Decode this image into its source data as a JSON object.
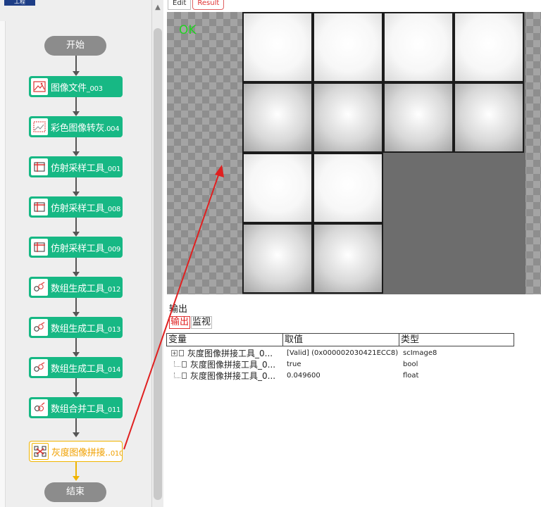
{
  "project_badge": "工程",
  "flow": {
    "start": "开始",
    "end": "结束",
    "nodes": [
      {
        "name": "图像文件",
        "suffix": "_003",
        "icon": "image-file-icon"
      },
      {
        "name": "彩色图像转灰",
        "suffix": ".004",
        "icon": "color-to-gray-icon"
      },
      {
        "name": "仿射采样工具",
        "suffix": "_001",
        "icon": "affine-sample-icon"
      },
      {
        "name": "仿射采样工具",
        "suffix": "_008",
        "icon": "affine-sample-icon"
      },
      {
        "name": "仿射采样工具",
        "suffix": "_009",
        "icon": "affine-sample-icon"
      },
      {
        "name": "数组生成工具",
        "suffix": "_012",
        "icon": "array-generate-icon"
      },
      {
        "name": "数组生成工具",
        "suffix": "_013",
        "icon": "array-generate-icon"
      },
      {
        "name": "数组生成工具",
        "suffix": "_014",
        "icon": "array-generate-icon"
      },
      {
        "name": "数组合并工具",
        "suffix": "_011",
        "icon": "array-merge-icon"
      },
      {
        "name": "灰度图像拼接..",
        "suffix": "010",
        "icon": "gray-image-stitch-icon"
      }
    ]
  },
  "image_tabs": [
    "Edit",
    "Result"
  ],
  "image_view": {
    "status": "OK"
  },
  "output": {
    "title": "输出",
    "tabs": [
      "输出",
      "监视"
    ],
    "columns": [
      "变量",
      "取值",
      "类型"
    ],
    "rows": [
      {
        "var": "灰度图像拼接工具_0...",
        "value": "[Valid] (0x000002030421ECC8)",
        "type": "scImage8",
        "toggle": "+"
      },
      {
        "var": "灰度图像拼接工具_0...",
        "value": "true",
        "type": "bool",
        "toggle": ""
      },
      {
        "var": "灰度图像拼接工具_0...",
        "value": "0.049600",
        "type": "float",
        "toggle": ""
      }
    ]
  },
  "colors": {
    "node_green": "#17b884",
    "selected_orange": "#f0b400",
    "ok_green": "#22d322",
    "arrow_red": "#e02020"
  }
}
